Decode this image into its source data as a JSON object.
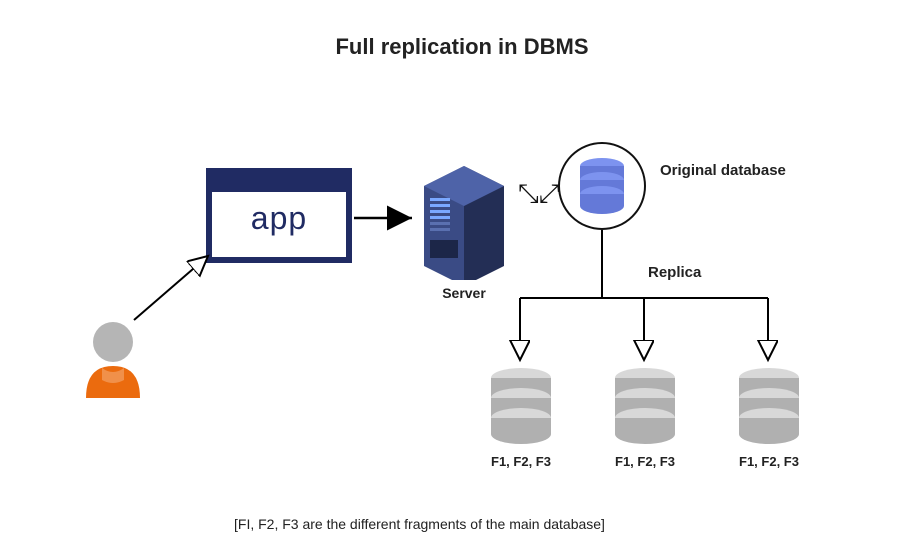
{
  "title": "Full replication in DBMS",
  "app_label": "app",
  "server_label": "Server",
  "original_db_label": "Original database",
  "replica_label": "Replica",
  "replica_fragments": [
    "F1, F2, F3",
    "F1, F2, F3",
    "F1, F2, F3"
  ],
  "footnote": "[FI, F2, F3 are the different fragments of the main database]",
  "colors": {
    "user_body": "#eb6b0e",
    "user_head": "#b5b5b5",
    "app_border": "#202b63",
    "server_dark": "#2a3761",
    "server_light": "#4a5c9a",
    "db_original": "#7d93ef",
    "db_replica": "#b8b8b8",
    "db_replica_light": "#d8d8d8"
  }
}
